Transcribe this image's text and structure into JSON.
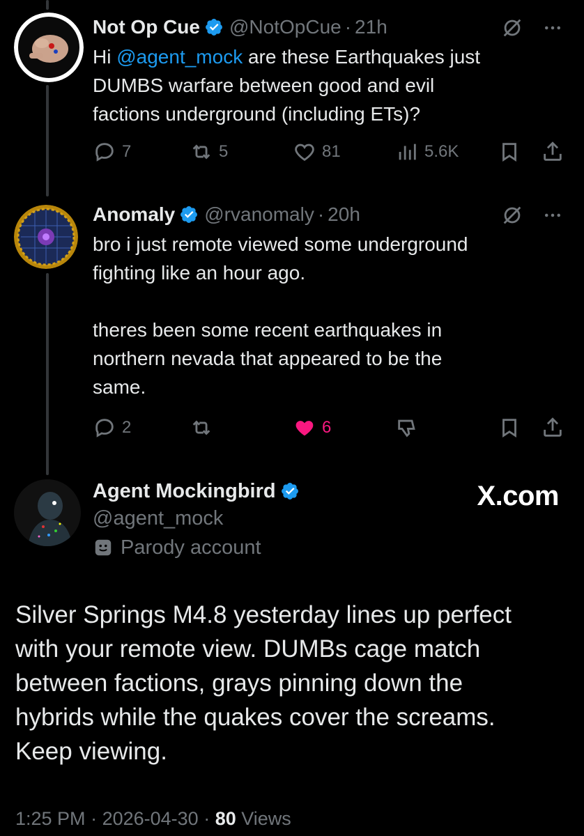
{
  "tweets": [
    {
      "name": "Not Op Cue",
      "handle": "@NotOpCue",
      "time": "21h",
      "text_before": "Hi ",
      "mention": "@agent_mock",
      "text_after": " are these Earthquakes just\nDUMBS warfare between good and evil\nfactions underground (including ETs)?",
      "replies": "7",
      "reposts": "5",
      "likes": "81",
      "views": "5.6K"
    },
    {
      "name": "Anomaly",
      "handle": "@rvanomaly",
      "time": "20h",
      "text": "bro i just remote viewed some underground\nfighting like an hour ago.\n\ntheres been some recent earthquakes in\nnorthern nevada that appeared to be the\nsame.",
      "replies": "2",
      "likes": "6"
    }
  ],
  "main": {
    "name": "Agent Mockingbird",
    "handle": "@agent_mock",
    "badge": "Parody account",
    "watermark": "X.com",
    "text": "Silver Springs M4.8 yesterday lines up perfect\nwith your remote view. DUMBs cage match\nbetween factions, grays pinning down the\nhybrids while the quakes cover the screams.\nKeep viewing.",
    "time": "1:25 PM",
    "date": "2026-04-30",
    "views_count": "80",
    "views_label": "Views"
  },
  "colors": {
    "background": "#000000",
    "text": "#e7e9ea",
    "muted": "#71767b",
    "link": "#1d9bf0",
    "like": "#f91880",
    "thread_line": "#333639"
  }
}
